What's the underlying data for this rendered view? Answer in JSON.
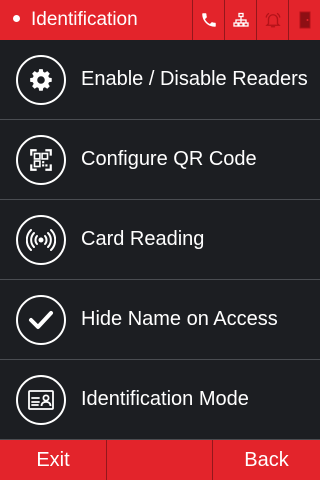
{
  "header": {
    "title": "Identification",
    "status_icons": [
      "phone-icon",
      "network-icon",
      "alarm-bell-icon",
      "door-icon"
    ]
  },
  "menu": {
    "items": [
      {
        "label": "Enable / Disable Readers",
        "icon": "gear-icon"
      },
      {
        "label": "Configure QR Code",
        "icon": "qr-code-icon"
      },
      {
        "label": "Card Reading",
        "icon": "contactless-card-icon"
      },
      {
        "label": "Hide Name on Access",
        "icon": "checkmark-icon"
      },
      {
        "label": "Identification Mode",
        "icon": "id-card-icon"
      }
    ]
  },
  "footer": {
    "exit_label": "Exit",
    "back_label": "Back"
  },
  "colors": {
    "accent": "#e3242b",
    "background": "#1c1e22",
    "divider": "#4a4d52",
    "text": "#ffffff"
  }
}
